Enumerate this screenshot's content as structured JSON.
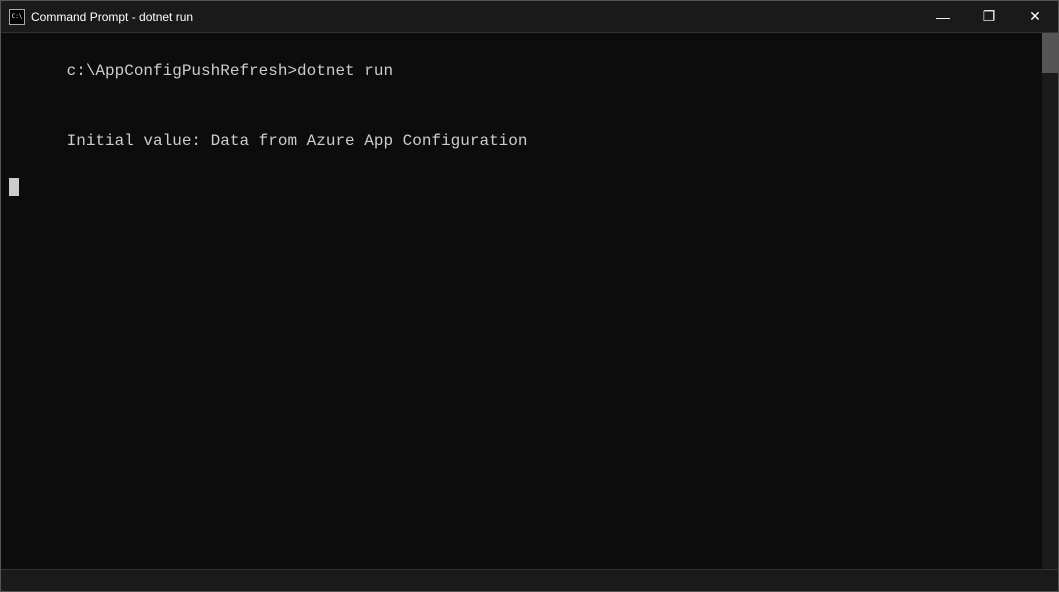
{
  "window": {
    "title": "Command Prompt - dotnet  run",
    "icon": "cmd-icon"
  },
  "controls": {
    "minimize": "—",
    "maximize": "❐",
    "close": "✕"
  },
  "terminal": {
    "line1_prompt": "c:\\AppConfigPushRefresh>",
    "line1_command": "dotnet run",
    "line2_output": "Initial value: Data from Azure App Configuration"
  },
  "statusbar": {
    "text": ""
  }
}
